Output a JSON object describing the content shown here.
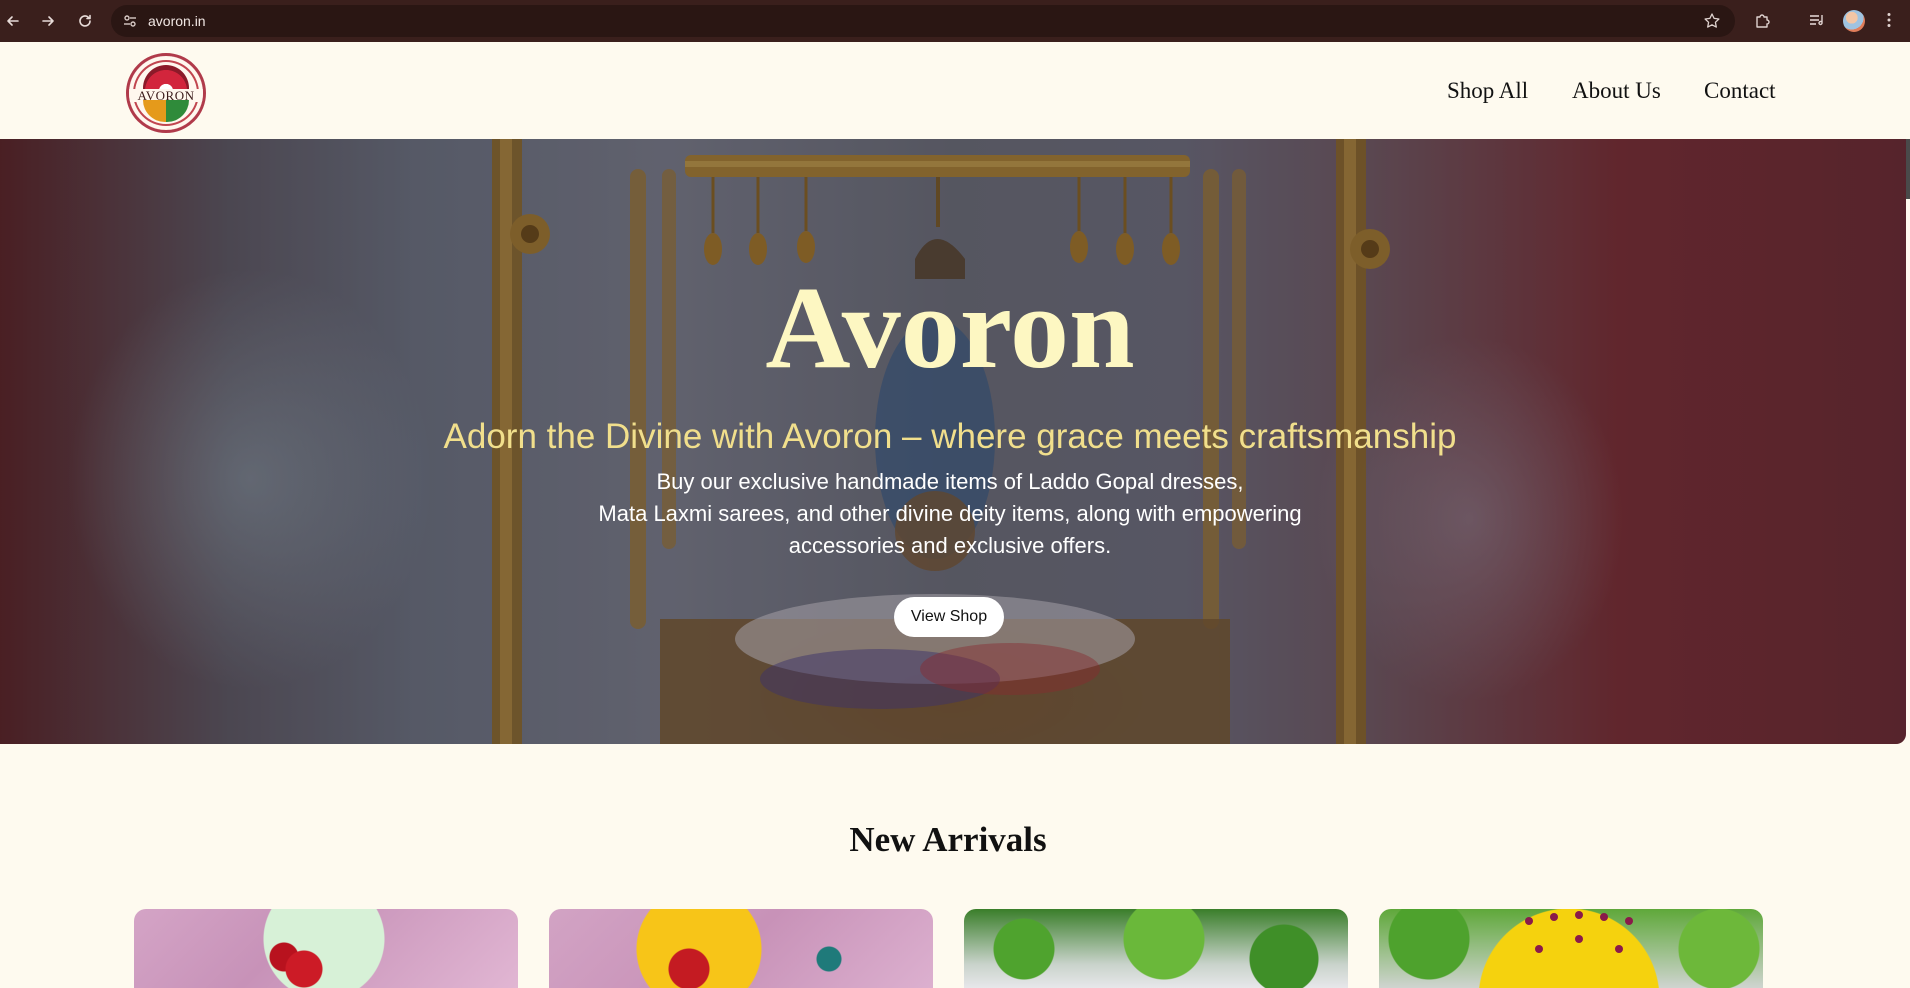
{
  "browser": {
    "url": "avoron.in",
    "icons": {
      "back": "arrow-left-icon",
      "forward": "arrow-right-icon",
      "reload": "reload-icon",
      "site_info": "tune-icon",
      "bookmark": "star-icon",
      "extensions": "puzzle-icon",
      "media": "media-control-icon",
      "profile": "avatar",
      "menu": "kebab-menu-icon"
    }
  },
  "header": {
    "logo_text": "AVORON",
    "nav": [
      "Shop All",
      "About Us",
      "Contact"
    ]
  },
  "hero": {
    "title": "Avoron",
    "tagline": "Adorn the Divine with Avoron – where grace meets craftsmanship",
    "description_lines": [
      "Buy our exclusive handmade items of Laddo Gopal dresses,",
      "Mata Laxmi sarees, and other divine deity items, along with empowering",
      "accessories and exclusive offers."
    ],
    "cta": "View Shop"
  },
  "new_arrivals": {
    "title": "New Arrivals",
    "product_count_visible": 4
  },
  "colors": {
    "page_background": "#fefaef",
    "browser_bar": "#3a1f1c",
    "hero_title": "#fdf7c2",
    "hero_tagline": "#f1df8c",
    "logo_accent": "#b03a4a"
  }
}
